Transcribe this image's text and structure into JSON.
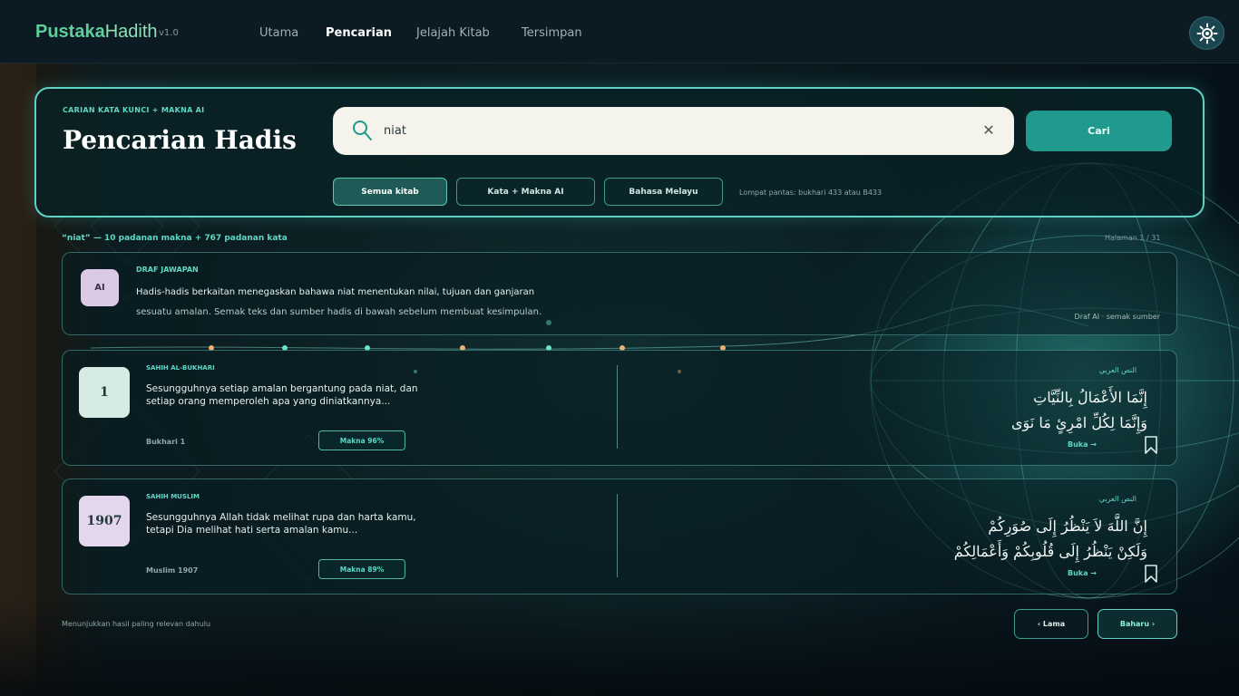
{
  "nav": {
    "brand_part1": "Pustaka",
    "brand_part2": "Hadith",
    "version": "v1.0",
    "items": [
      {
        "label": "Utama"
      },
      {
        "label": "Pencarian"
      },
      {
        "label": "Jelajah Kitab"
      },
      {
        "label": "Tersimpan"
      }
    ],
    "active": "Pencarian",
    "theme_toggle_icon": "gear-icon"
  },
  "search": {
    "kicker": "CARIAN KATA KUNCI + MAKNA AI",
    "title": "Pencarian Hadis",
    "query": "niat",
    "clear_label": "✕",
    "submit_label": "Cari",
    "filters": [
      {
        "label": "Semua kitab"
      },
      {
        "label": "Kata + Makna AI"
      },
      {
        "label": "Bahasa Melayu"
      }
    ],
    "jump_hint": "Lompat pantas: bukhari 433 atau B433"
  },
  "results": {
    "summary": "“niat” — 10 padanan makna + 767 padanan kata",
    "page_indicator": "Halaman 1 / 31",
    "ai_draft": {
      "badge": "AI",
      "kicker": "DRAF JAWAPAN",
      "line1": "Hadis-hadis berkaitan menegaskan bahawa niat menentukan nilai, tujuan dan ganjaran",
      "line2": "sesuatu amalan. Semak teks dan sumber hadis di bawah sebelum membuat kesimpulan.",
      "note": "Draf AI · semak sumber"
    },
    "items": [
      {
        "number": "1",
        "badge_color": "#d6ece2",
        "source": "SAHIH AL-BUKHARI",
        "text": "Sesungguhnya setiap amalan bergantung pada niat, dan setiap orang memperoleh apa yang diniatkannya...",
        "ref": "Bukhari 1",
        "makna": "Makna 96%",
        "arab_label": "النص العربي",
        "arab_line1": "إِنَّمَا الأَعْمَالُ بِالنِّيَّاتِ",
        "arab_line2": "وَإِنَّمَا لِكُلِّ امْرِئٍ مَا نَوَى",
        "open_label": "Buka →"
      },
      {
        "number": "1907",
        "badge_color": "#e4d6ec",
        "source": "SAHIH MUSLIM",
        "text": "Sesungguhnya Allah tidak melihat rupa dan harta kamu, tetapi Dia melihat hati serta amalan kamu...",
        "ref": "Muslim 1907",
        "makna": "Makna 89%",
        "arab_label": "النص العربي",
        "arab_line1": "إِنَّ اللَّهَ لاَ يَنْظُرُ إِلَى صُوَرِكُمْ",
        "arab_line2": "وَلَكِنْ يَنْظُرُ إِلَى قُلُوبِكُمْ وَأَعْمَالِكُمْ",
        "open_label": "Buka →"
      }
    ],
    "footer_note": "Menunjukkan hasil paling relevan dahulu",
    "prev_label": "‹ Lama",
    "next_label": "Baharu ›"
  },
  "colors": {
    "accent": "#5fd8c6",
    "button": "#1f9a8c",
    "brand": "#5fcf9a"
  }
}
